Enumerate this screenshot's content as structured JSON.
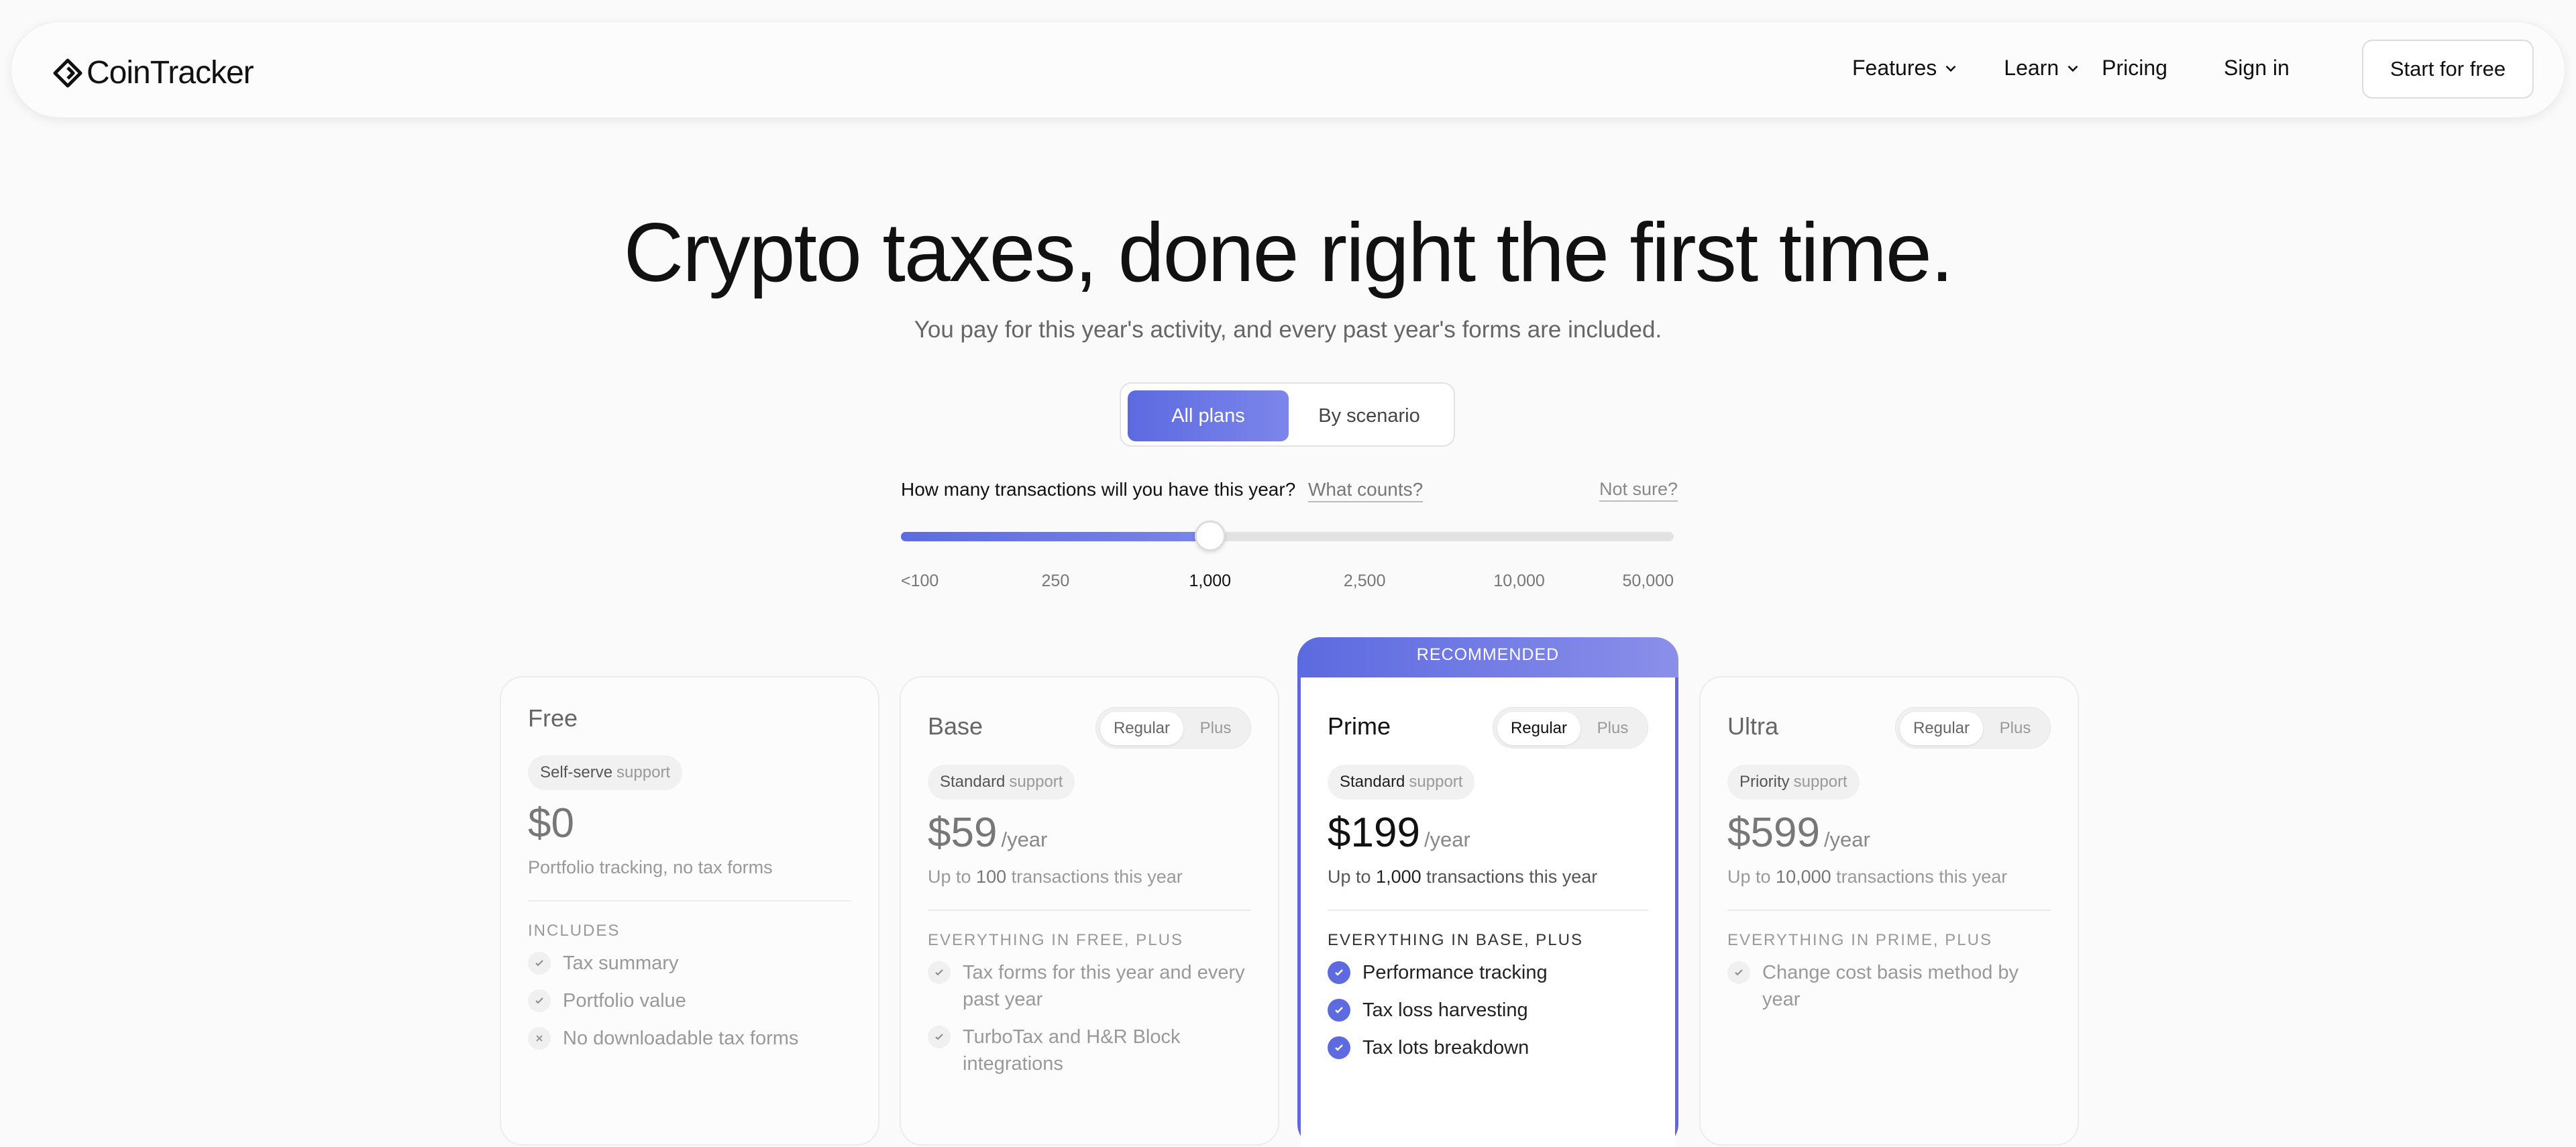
{
  "brand": {
    "name": "CoinTracker"
  },
  "nav": {
    "features": "Features",
    "learn": "Learn",
    "pricing": "Pricing",
    "signin": "Sign in",
    "cta": "Start for free"
  },
  "hero": {
    "title": "Crypto taxes, done right the first time.",
    "subtitle": "You pay for this year's activity, and every past year's forms are included."
  },
  "toggle": {
    "active": "All plans",
    "inactive": "By scenario"
  },
  "slider": {
    "question": "How many transactions will you have this year?",
    "what_counts": "What counts?",
    "not_sure": "Not sure?",
    "ticks": [
      "<100",
      "250",
      "1,000",
      "2,500",
      "10,000",
      "50,000"
    ],
    "selected": "1,000",
    "accent": "#5c6ae0"
  },
  "plans": [
    {
      "name": "Free",
      "support_level": "Self-serve",
      "support_word": "support",
      "price": "$0",
      "per": "",
      "desc_pre": "",
      "desc_num": "",
      "desc_post": "Portfolio tracking, no tax forms",
      "includes": "INCLUDES",
      "features": [
        "Tax summary",
        "Portfolio value",
        "No downloadable tax forms"
      ],
      "feature_icons": [
        "check-icon",
        "check-icon",
        "x-icon"
      ]
    },
    {
      "name": "Base",
      "toggle_a": "Regular",
      "toggle_b": "Plus",
      "support_level": "Standard",
      "support_word": "support",
      "price": "$59",
      "per": "/year",
      "desc_pre": "Up to ",
      "desc_num": "100",
      "desc_post": " transactions this year",
      "includes": "EVERYTHING IN FREE, PLUS",
      "features": [
        "Tax forms for this year and every past year",
        "TurboTax and H&R Block integrations"
      ]
    },
    {
      "name": "Prime",
      "recommended": "RECOMMENDED",
      "toggle_a": "Regular",
      "toggle_b": "Plus",
      "support_level": "Standard",
      "support_word": "support",
      "price": "$199",
      "per": "/year",
      "desc_pre": "Up to ",
      "desc_num": "1,000",
      "desc_post": " transactions this year",
      "includes": "EVERYTHING IN BASE, PLUS",
      "features": [
        "Performance tracking",
        "Tax loss harvesting",
        "Tax lots breakdown"
      ]
    },
    {
      "name": "Ultra",
      "toggle_a": "Regular",
      "toggle_b": "Plus",
      "support_level": "Priority",
      "support_word": "support",
      "price": "$599",
      "per": "/year",
      "desc_pre": "Up to ",
      "desc_num": "10,000",
      "desc_post": " transactions this year",
      "includes": "EVERYTHING IN PRIME, PLUS",
      "features": [
        "Change cost basis method by year"
      ]
    }
  ]
}
